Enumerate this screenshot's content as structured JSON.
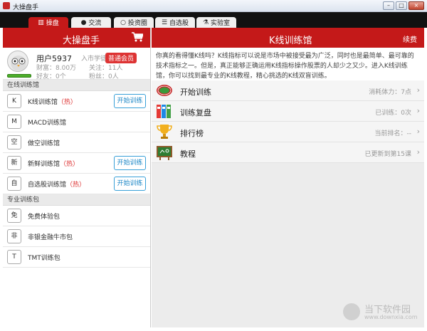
{
  "window": {
    "title": "大操盘手"
  },
  "tabs": [
    {
      "label": "操盘",
      "icon": "bar-chart-icon",
      "active": true
    },
    {
      "label": "交流",
      "icon": "user-icon",
      "active": false
    },
    {
      "label": "投资圈",
      "icon": "circle-icon",
      "active": false
    },
    {
      "label": "自选股",
      "icon": "list-icon",
      "active": false
    },
    {
      "label": "实验室",
      "icon": "flask-icon",
      "active": false
    }
  ],
  "left": {
    "title": "大操盘手",
    "user": {
      "name": "用户5937",
      "level": "入市学徒",
      "badge": "普通会员",
      "wealth": "财富：8.00万",
      "follow": "关注：11人",
      "friends": "好友：0个",
      "fans": "粉丝：0人"
    },
    "section_online": "在线训练馆",
    "online": [
      {
        "key": "K",
        "label": "K线训练馆",
        "hot": "（热）",
        "button": "开始训练"
      },
      {
        "key": "M",
        "label": "MACD训练馆",
        "hot": "",
        "button": ""
      },
      {
        "key": "空",
        "label": "做空训练馆",
        "hot": "",
        "button": ""
      },
      {
        "key": "新",
        "label": "新鲜训练馆",
        "hot": "（热）",
        "button": "开始训练"
      },
      {
        "key": "自",
        "label": "自选股训练馆",
        "hot": "（热）",
        "button": "开始训练"
      }
    ],
    "section_pack": "专业训练包",
    "packs": [
      {
        "key": "免",
        "label": "免费体验包"
      },
      {
        "key": "非",
        "label": "非银金融牛市包"
      },
      {
        "key": "T",
        "label": "TMT训练包"
      }
    ]
  },
  "right": {
    "title": "K线训练馆",
    "renew": "续费",
    "intro": "你真的看得懂K线吗？K线指标可以说是市场中被接受最为广泛，同时也是最简单、最可靠的技术指标之一。但是，真正能够正确运用K线指标操作股票的人却少之又少。进入K线训练馆，你可以找到最专业的K线教程，精心挑选的K线双盲训练。",
    "items": [
      {
        "label": "开始训练",
        "right": "消耗体力：7点",
        "icon": "track-icon"
      },
      {
        "label": "训练复盘",
        "right": "已训练：0次",
        "icon": "binders-icon"
      },
      {
        "label": "排行榜",
        "right": "当前排名：--",
        "icon": "trophy-icon"
      },
      {
        "label": "教程",
        "right": "已更新到第15课",
        "icon": "chalkboard-icon"
      }
    ]
  },
  "watermark": {
    "line1": "当下软件园",
    "line2": "www.downxia.com"
  },
  "colors": {
    "accent": "#c41919",
    "button": "#1e88c7",
    "hot": "#dd3333"
  }
}
